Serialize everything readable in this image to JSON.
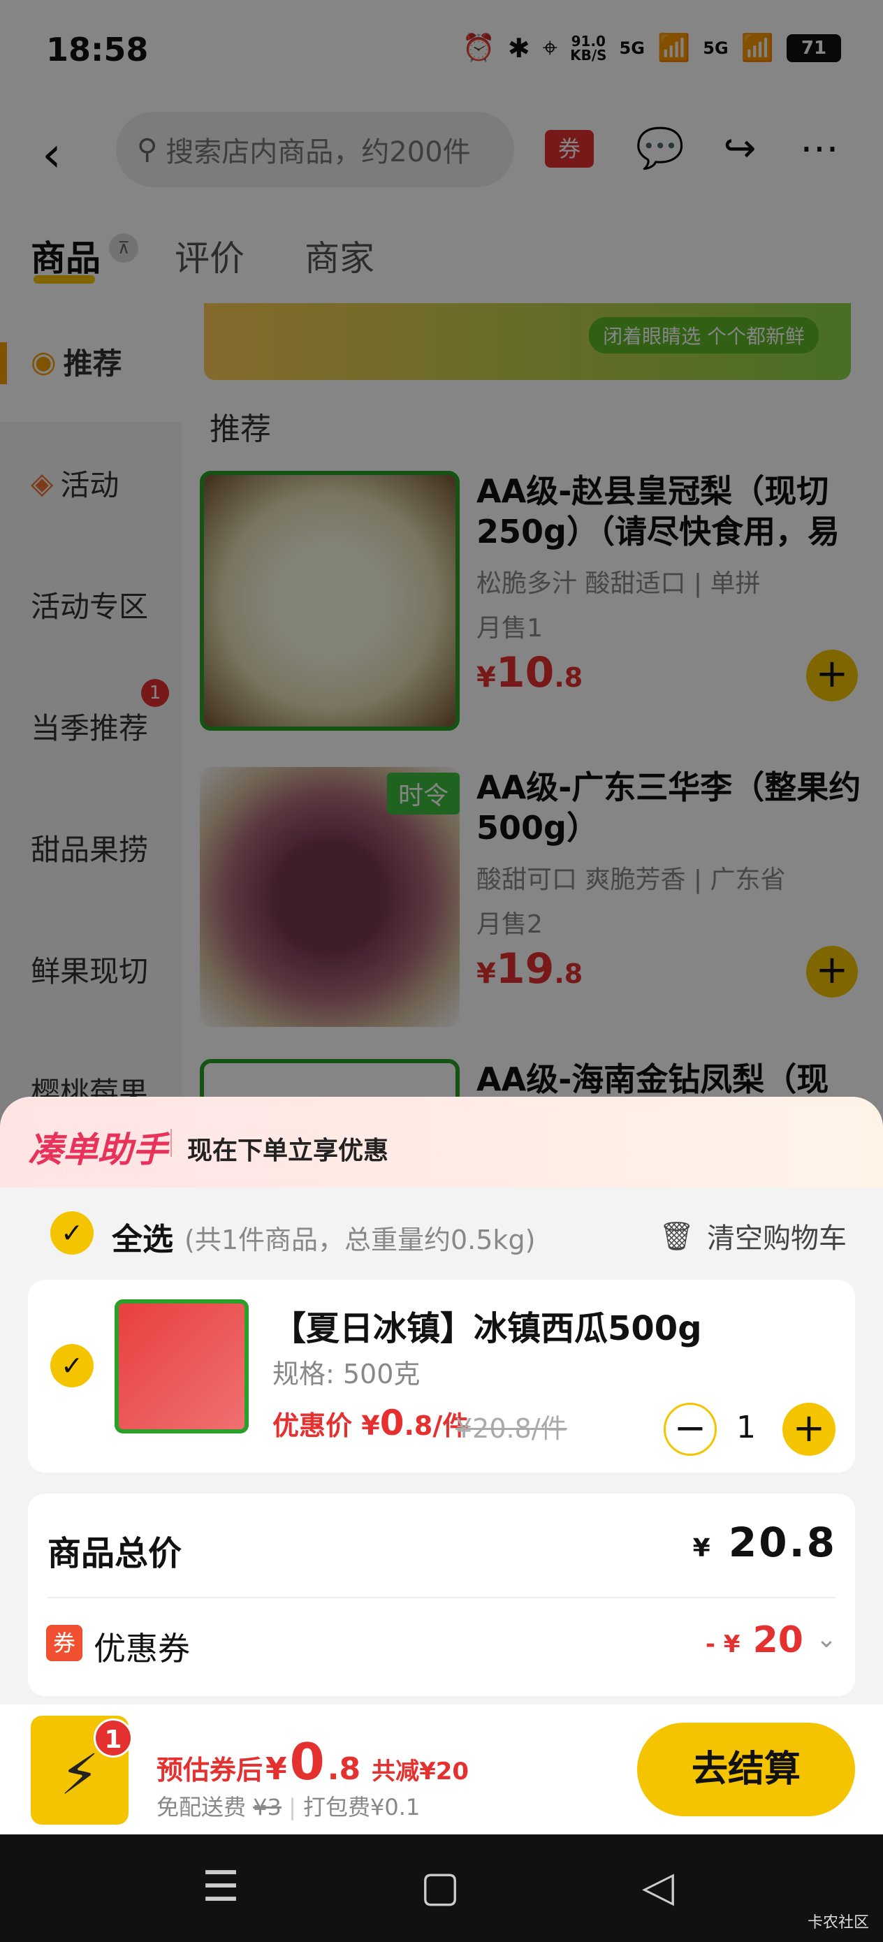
{
  "status_bar": {
    "time": "18:58",
    "net_speed_value": "91.0",
    "net_speed_unit": "KB/S",
    "signal1": "5G",
    "signal2": "5G",
    "battery": "71"
  },
  "header": {
    "search_placeholder": "搜索店内商品，约200件",
    "coupon_label": "券"
  },
  "tabs": [
    {
      "label": "商品"
    },
    {
      "label": "评价"
    },
    {
      "label": "商家"
    }
  ],
  "sidebar": {
    "items": [
      {
        "label": "推荐"
      },
      {
        "label": "活动"
      },
      {
        "label": "活动专区"
      },
      {
        "label": "当季推荐",
        "badge": "1"
      },
      {
        "label": "甜品果捞"
      },
      {
        "label": "鲜果现切"
      },
      {
        "label": "樱桃莓果"
      }
    ]
  },
  "content": {
    "banner_text": "闭着眼睛选 个个都新鲜",
    "section_title": "推荐",
    "products": [
      {
        "name": "AA级-赵县皇冠梨（现切250g）（请尽快食用，易",
        "desc": "松脆多汁 酸甜适口 | 单拼",
        "sales": "月售1",
        "price_symbol": "¥",
        "price_int": "10",
        "price_dec": ".8"
      },
      {
        "name": "AA级-广东三华李（整果约500g）",
        "desc": "酸甜可口 爽脆芳香 | 广东省",
        "sales": "月售2",
        "price_symbol": "¥",
        "price_int": "19",
        "price_dec": ".8",
        "tag": "时令"
      },
      {
        "name": "AA级-海南金钻凤梨（现"
      }
    ]
  },
  "cart_sheet": {
    "helper_title": "凑单助手",
    "helper_text": "现在下单立享优惠",
    "select_all": "全选",
    "select_summary": "(共1件商品，总重量约0.5kg)",
    "clear_cart": "清空购物车",
    "item": {
      "name": "【夏日冰镇】冰镇西瓜500g",
      "spec": "规格: 500克",
      "price_label": "优惠价",
      "price_symbol": "¥",
      "price_int": "0",
      "price_dec": ".8/件",
      "original_price": "¥20.8/件",
      "quantity": "1"
    },
    "total_label": "商品总价",
    "total_symbol": "¥",
    "total_value": "20.8",
    "coupon_icon": "券",
    "coupon_label": "优惠券",
    "coupon_prefix": "- ¥",
    "coupon_value": "20"
  },
  "footer": {
    "cart_count": "1",
    "estimate_label": "预估券后",
    "estimate_symbol": "¥",
    "estimate_int": "0",
    "estimate_dec": ".8",
    "saving": "共减¥20",
    "delivery_label": "免配送费",
    "delivery_orig": "¥3",
    "packing_fee": "打包费¥0.1",
    "checkout_label": "去结算"
  },
  "watermark": "卡农社区",
  "colors": {
    "accent_yellow": "#f5c400",
    "price_red": "#e53030",
    "helper_pink": "#e8325a"
  }
}
